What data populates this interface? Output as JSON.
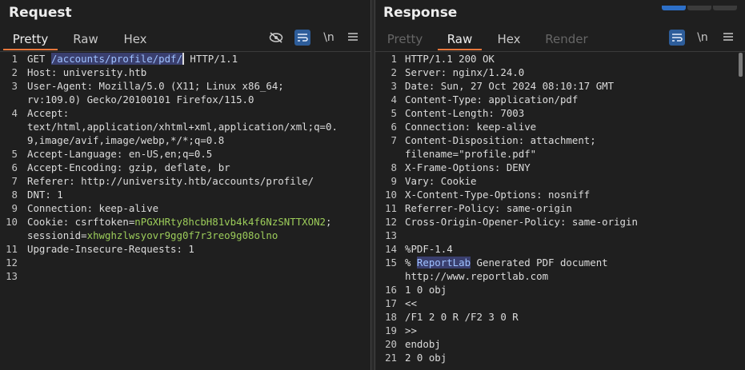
{
  "request": {
    "title": "Request",
    "tabs": [
      {
        "label": "Pretty",
        "state": "active"
      },
      {
        "label": "Raw",
        "state": "normal"
      },
      {
        "label": "Hex",
        "state": "normal"
      }
    ],
    "toolbar": {
      "newline_label": "\\n"
    },
    "lines": [
      {
        "n": "1",
        "pre": "GET ",
        "hl": "/accounts/profile/pdf/",
        "post": " HTTP/1.1"
      },
      {
        "n": "2",
        "text": "Host: university.htb"
      },
      {
        "n": "3",
        "text": "User-Agent: Mozilla/5.0 (X11; Linux x86_64;"
      },
      {
        "n": "",
        "text": "rv:109.0) Gecko/20100101 Firefox/115.0"
      },
      {
        "n": "4",
        "text": "Accept:"
      },
      {
        "n": "",
        "text": "text/html,application/xhtml+xml,application/xml;q=0."
      },
      {
        "n": "",
        "text": "9,image/avif,image/webp,*/*;q=0.8"
      },
      {
        "n": "5",
        "text": "Accept-Language: en-US,en;q=0.5"
      },
      {
        "n": "6",
        "text": "Accept-Encoding: gzip, deflate, br"
      },
      {
        "n": "7",
        "text": "Referer: http://university.htb/accounts/profile/"
      },
      {
        "n": "8",
        "text": "DNT: 1"
      },
      {
        "n": "9",
        "text": "Connection: keep-alive"
      },
      {
        "n": "10",
        "cpre": "Cookie: csrftoken=",
        "cval": "nPGXHRty8hcbH81vb4k4f6NzSNTTXON2",
        "cpost": ";"
      },
      {
        "n": "",
        "cpre": "sessionid=",
        "cval": "xhwghzlwsyovr9gg0f7r3reo9g08olno",
        "cpost": ""
      },
      {
        "n": "11",
        "text": "Upgrade-Insecure-Requests: 1"
      },
      {
        "n": "12",
        "text": ""
      },
      {
        "n": "13",
        "text": ""
      }
    ]
  },
  "response": {
    "title": "Response",
    "tabs": [
      {
        "label": "Pretty",
        "state": "disabled"
      },
      {
        "label": "Raw",
        "state": "active"
      },
      {
        "label": "Hex",
        "state": "normal"
      },
      {
        "label": "Render",
        "state": "disabled"
      }
    ],
    "toolbar": {
      "newline_label": "\\n"
    },
    "lines": [
      {
        "n": "1",
        "text": "HTTP/1.1 200 OK"
      },
      {
        "n": "2",
        "text": "Server: nginx/1.24.0"
      },
      {
        "n": "3",
        "text": "Date: Sun, 27 Oct 2024 08:10:17 GMT"
      },
      {
        "n": "4",
        "text": "Content-Type: application/pdf"
      },
      {
        "n": "5",
        "text": "Content-Length: 7003"
      },
      {
        "n": "6",
        "text": "Connection: keep-alive"
      },
      {
        "n": "7",
        "text": "Content-Disposition: attachment;"
      },
      {
        "n": "",
        "text": "filename=\"profile.pdf\""
      },
      {
        "n": "8",
        "text": "X-Frame-Options: DENY"
      },
      {
        "n": "9",
        "text": "Vary: Cookie"
      },
      {
        "n": "10",
        "text": "X-Content-Type-Options: nosniff"
      },
      {
        "n": "11",
        "text": "Referrer-Policy: same-origin"
      },
      {
        "n": "12",
        "text": "Cross-Origin-Opener-Policy: same-origin"
      },
      {
        "n": "13",
        "text": ""
      },
      {
        "n": "14",
        "text": "%PDF-1.4"
      },
      {
        "n": "15",
        "pre": "% ",
        "hl": "ReportLab",
        "post": " Generated PDF document"
      },
      {
        "n": "",
        "text": "http://www.reportlab.com"
      },
      {
        "n": "16",
        "text": "1 0 obj"
      },
      {
        "n": "17",
        "text": "<<"
      },
      {
        "n": "18",
        "text": "/F1 2 0 R /F2 3 0 R"
      },
      {
        "n": "19",
        "text": ">>"
      },
      {
        "n": "20",
        "text": "endobj"
      },
      {
        "n": "21",
        "text": "2 0 obj"
      }
    ]
  },
  "colors": {
    "background": "#1f1f1f",
    "accent_tab": "#e8773c",
    "highlight_bg": "#3a3f6e",
    "highlight_fg": "#9ec1ff",
    "cookie_value": "#9ccc5a",
    "toggle_on": "#2d5d9a"
  },
  "icons": {
    "hide": "eye-slash-icon",
    "wrap": "wrap-lines-icon",
    "menu": "hamburger-menu-icon"
  }
}
